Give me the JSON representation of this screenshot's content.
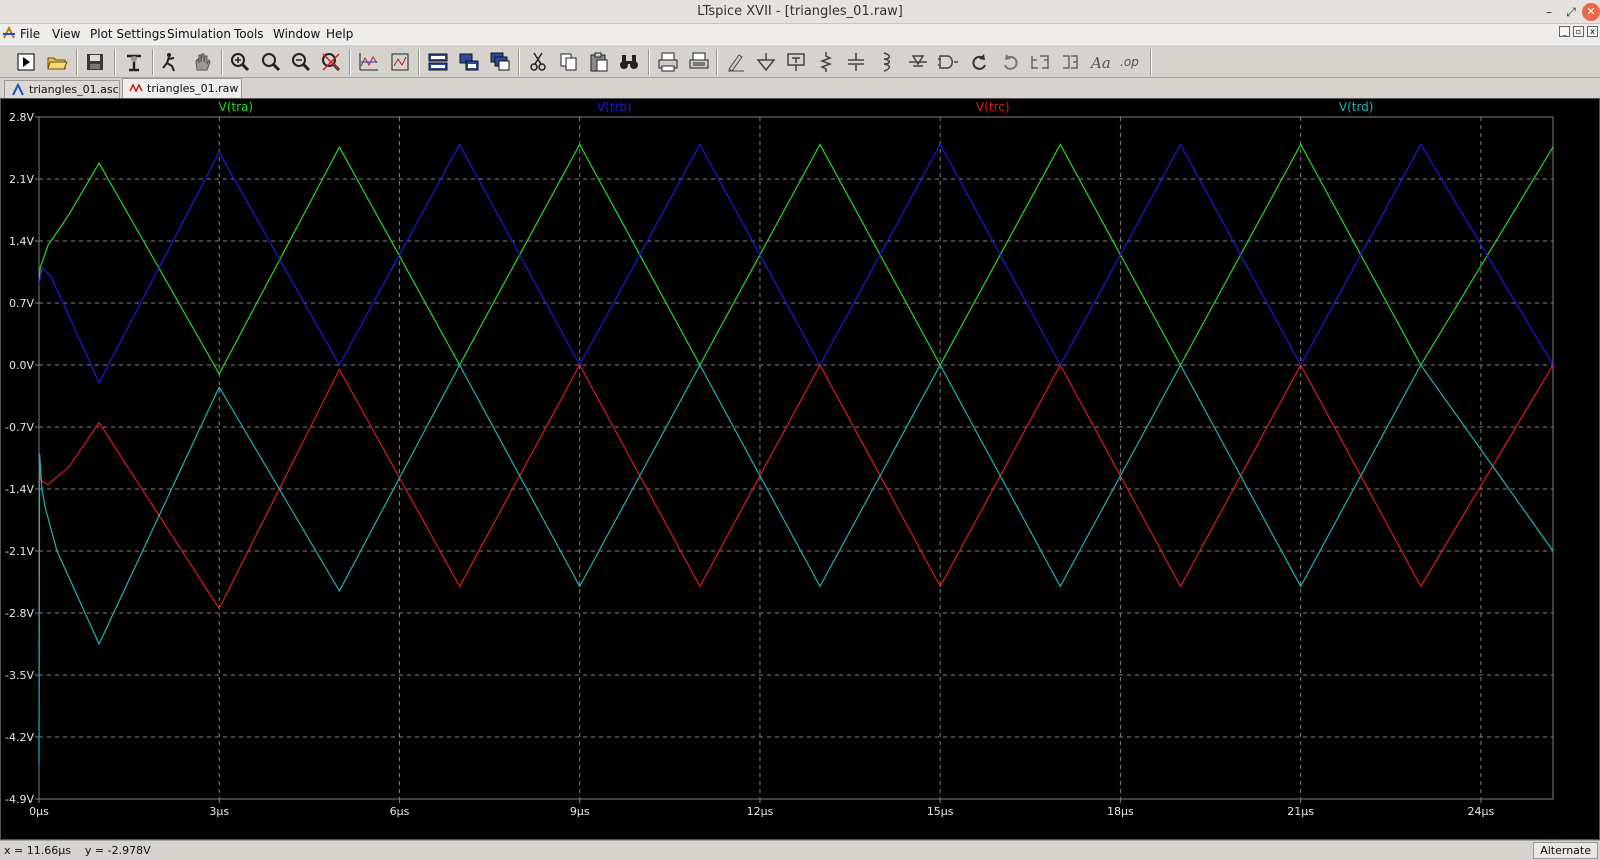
{
  "window": {
    "title": "LTspice XVII - [triangles_01.raw]",
    "controls": {
      "minimize": "–",
      "maximize": "⤢",
      "close": "✕"
    }
  },
  "menubar": {
    "items": [
      "File",
      "View",
      "Plot Settings",
      "Simulation",
      "Tools",
      "Window",
      "Help"
    ],
    "mdi_controls": [
      "_",
      "▫",
      "x"
    ]
  },
  "toolbar": {
    "buttons": [
      "run-icon",
      "open-icon",
      "save-icon",
      "control-panel-icon",
      "halt-icon",
      "pan-hand-icon",
      "zoom-in-icon",
      "zoom-area-icon",
      "zoom-out-icon",
      "zoom-cancel-icon",
      "autorange-icon",
      "edit-plot-icon",
      "tile-horizontal-icon",
      "tile-vertical-icon",
      "cascade-icon",
      "cut-icon",
      "copy-icon",
      "paste-icon",
      "find-icon",
      "print-icon",
      "print-preview-icon",
      "draw-wire-icon",
      "ground-icon",
      "label-net-icon",
      "resistor-icon",
      "capacitor-icon",
      "inductor-icon",
      "diode-icon",
      "component-icon",
      "rotate-icon",
      "mirror-icon",
      "undo-icon",
      "redo-icon",
      "text-icon",
      "spice-directive-icon"
    ]
  },
  "tabs": [
    {
      "label": "triangles_01.asc",
      "icon": "schematic-icon",
      "active": false
    },
    {
      "label": "triangles_01.raw",
      "icon": "waveform-icon",
      "active": true
    }
  ],
  "colors": {
    "background": "#000000",
    "grid": "#808080",
    "axis_text": "#e6e6e6",
    "tra": "#22dd22",
    "trb": "#1a1add",
    "trc": "#dd1a1a",
    "trd": "#1ab4b4"
  },
  "chart_data": {
    "type": "line",
    "xlabel": "",
    "ylabel": "",
    "xlim": [
      0,
      25.2
    ],
    "ylim": [
      -4.9,
      2.8
    ],
    "x_ticks": [
      0,
      3,
      6,
      9,
      12,
      15,
      18,
      21,
      24
    ],
    "x_tick_labels": [
      "0µs",
      "3µs",
      "6µs",
      "9µs",
      "12µs",
      "15µs",
      "18µs",
      "21µs",
      "24µs"
    ],
    "y_ticks": [
      2.8,
      2.1,
      1.4,
      0.7,
      0.0,
      -0.7,
      -1.4,
      -2.1,
      -2.8,
      -3.5,
      -4.2,
      -4.9
    ],
    "y_tick_labels": [
      "2.8V",
      "2.1V",
      "1.4V",
      "0.7V",
      "0.0V",
      "-0.7V",
      "-1.4V",
      "-2.1V",
      "-2.8V",
      "-3.5V",
      "-4.2V",
      "-4.9V"
    ],
    "grid": true,
    "legend": "top",
    "series": [
      {
        "name": "V(tra)",
        "color": "#22dd22",
        "x": [
          0,
          0.02,
          0.15,
          0.5,
          1.0,
          3.0,
          5.0,
          7.0,
          9.0,
          11.0,
          13.0,
          15.0,
          17.0,
          19.0,
          21.0,
          23.0,
          25.2
        ],
        "y": [
          0.9,
          1.1,
          1.35,
          1.7,
          2.28,
          -0.1,
          2.46,
          0.0,
          2.49,
          0.0,
          2.49,
          0.0,
          2.49,
          0.0,
          2.49,
          0.0,
          2.46
        ]
      },
      {
        "name": "V(trb)",
        "color": "#1a1add",
        "x": [
          0,
          0.05,
          0.2,
          1.0,
          3.0,
          5.0,
          7.0,
          9.0,
          11.0,
          13.0,
          15.0,
          17.0,
          19.0,
          21.0,
          23.0,
          25.2
        ],
        "y": [
          0.9,
          1.1,
          1.0,
          -0.2,
          2.4,
          0.0,
          2.49,
          0.0,
          2.49,
          0.0,
          2.49,
          0.0,
          2.49,
          0.0,
          2.49,
          0.0
        ]
      },
      {
        "name": "V(trc)",
        "color": "#dd1a1a",
        "x": [
          0,
          0.03,
          0.15,
          0.5,
          1.0,
          3.0,
          5.0,
          7.0,
          9.0,
          11.0,
          13.0,
          15.0,
          17.0,
          19.0,
          21.0,
          23.0,
          25.2
        ],
        "y": [
          -1.15,
          -1.3,
          -1.35,
          -1.15,
          -0.65,
          -2.75,
          -0.05,
          -2.5,
          0.0,
          -2.5,
          0.0,
          -2.5,
          0.0,
          -2.5,
          0.0,
          -2.5,
          0.0
        ]
      },
      {
        "name": "V(trd)",
        "color": "#1ab4b4",
        "x": [
          0,
          0.01,
          0.05,
          0.1,
          0.3,
          1.0,
          3.0,
          5.0,
          7.0,
          9.0,
          11.0,
          13.0,
          15.0,
          17.0,
          19.0,
          21.0,
          23.0,
          25.2
        ],
        "y": [
          -4.5,
          -1.0,
          -1.4,
          -1.6,
          -2.1,
          -3.15,
          -0.25,
          -2.55,
          0.0,
          -2.5,
          0.0,
          -2.5,
          0.0,
          -2.5,
          0.0,
          -2.5,
          0.0,
          -2.1
        ]
      }
    ]
  },
  "statusbar": {
    "coords": "x = 11.66µs    y = -2.978V",
    "mode": "Alternate"
  }
}
